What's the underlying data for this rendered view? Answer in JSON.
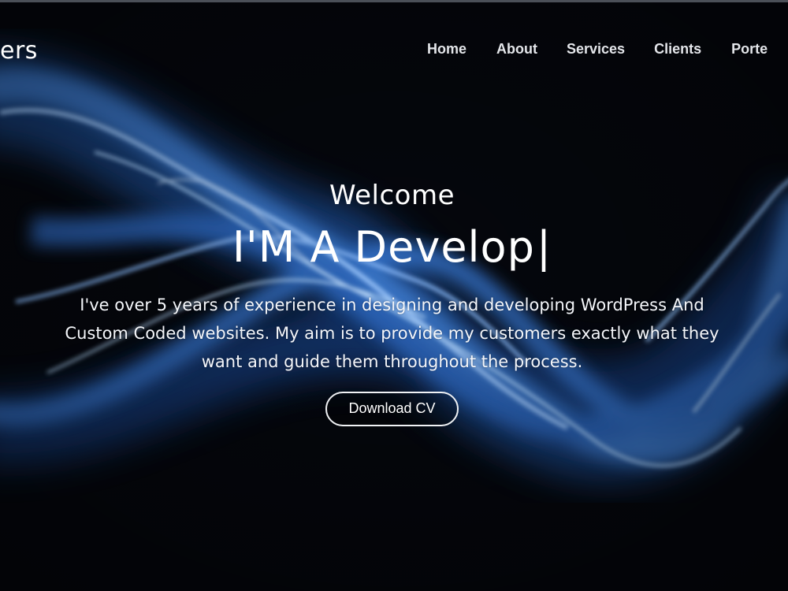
{
  "header": {
    "brand_text": "ers"
  },
  "nav": {
    "items": [
      {
        "label": "Home"
      },
      {
        "label": "About"
      },
      {
        "label": "Services"
      },
      {
        "label": "Clients"
      },
      {
        "label": "Porte"
      }
    ]
  },
  "hero": {
    "greeting": "Welcome",
    "headline": "I'M A Develop",
    "cursor": "|",
    "intro": "I've over 5 years of experience in designing and developing WordPress And Custom Coded websites. My aim is to provide my customers exactly what they want and guide them throughout the process.",
    "button_label": "Download CV"
  },
  "colors": {
    "background": "#05070d",
    "smoke_blue": "#5c9eea",
    "text": "#ffffff"
  }
}
